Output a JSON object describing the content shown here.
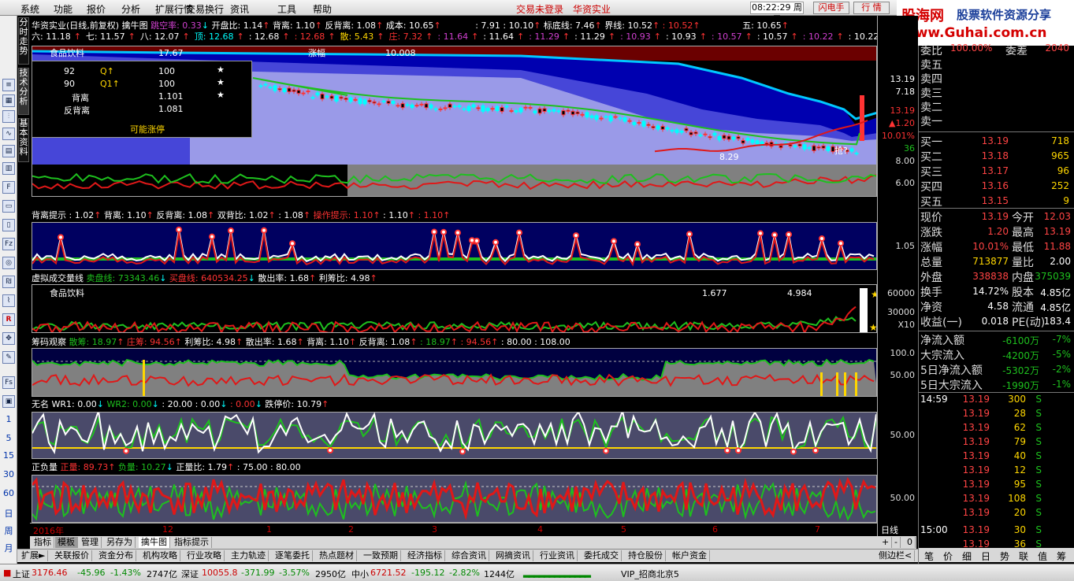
{
  "menu": {
    "items": [
      "系统",
      "功能",
      "报价",
      "分析",
      "扩展行情",
      "交易换行",
      "资讯",
      "工具",
      "帮助"
    ],
    "login": "交易未登录",
    "stock": "华资实业",
    "clock": "08:22:29 周二",
    "flash": "闪电手",
    "quote": "行 情"
  },
  "logo": {
    "line1": "股海网",
    "line1b": "股票软件资源分享",
    "line2": "www.Guhai.com.cn"
  },
  "sidetabs": [
    "分时走势",
    "技术分析",
    "基本资料"
  ],
  "left_nums": [
    "1",
    "5",
    "15",
    "30",
    "60",
    "日",
    "周",
    "月"
  ],
  "main": {
    "row1": {
      "name": "华资实业(日线,前复权)",
      "ind": "擒牛图",
      "a": "跳空率: 0.33",
      "b": "开盘比: 1.14",
      "c": "背离: 1.10",
      "d": "反背离: 1.08",
      "e": "成本: 10.65",
      "f": ": 7.91",
      "g": ": 10.10",
      "h": "标底线: 7.46",
      "i": "界线: 10.52",
      "j": ": 10.52",
      "k": "五: 10.65"
    },
    "row2": [
      "六: 11.18",
      "七: 11.57",
      "八: 12.07",
      "顶: 12.68",
      ": 12.68",
      ": 12.68",
      "散: 5.43",
      "庄: 7.32",
      ": 11.64",
      ": 11.64",
      ": 11.29",
      ": 11.29",
      ": 10.93",
      ": 10.93",
      ": 10.57",
      ": 10.57",
      ": 10.22",
      ": 10.22"
    ],
    "sector": "食品饮料",
    "flag": "17.67",
    "rise_label": "涨幅",
    "rise_val": "10.008",
    "low_label": "8.29",
    "pick_label": "抢?",
    "info": {
      "rows": [
        [
          "92",
          "Q↑",
          "100"
        ],
        [
          "90",
          "Q1↑",
          "100"
        ],
        [
          "",
          "背离",
          "1.101"
        ],
        [
          "",
          "反背离",
          "1.081"
        ]
      ],
      "footer": "可能涨停"
    }
  },
  "p2": {
    "title": "背离提示",
    "vals": [
      ": 1.02",
      "背离: 1.10",
      "反背离: 1.08",
      "双背比: 1.02",
      ": 1.08",
      "操作提示: 1.10",
      ": 1.10",
      ": 1.10"
    ],
    "tick": "1.05"
  },
  "p3": {
    "title": "虚拟成交量线",
    "vals": [
      "卖盘线: 73343.46",
      "买盘线: 640534.25",
      "散出率: 1.68",
      "利筹比: 4.98"
    ],
    "sector": "食品饮料",
    "v1": "1.677",
    "v2": "4.984",
    "ticks": [
      "60000",
      "30000",
      "X10"
    ]
  },
  "p4": {
    "title": "筹码观察",
    "vals": [
      "散筹: 18.97",
      "庄筹: 94.56",
      "利筹比: 4.98",
      "散出率: 1.68",
      "背离: 1.10",
      "反背离: 1.08",
      ": 18.97",
      ": 94.56",
      ": 80.00 : 108.00"
    ],
    "ticks": [
      "100.0",
      "50.00"
    ]
  },
  "p5": {
    "title": "无名",
    "vals": [
      "WR1: 0.00",
      "WR2: 0.00",
      ": 20.00 : 0.00",
      ": 0.00",
      "跌停价: 10.79"
    ],
    "tick": "50.00"
  },
  "p6": {
    "title": "正负量",
    "vals": [
      "正量: 89.73",
      "负量: 10.27",
      "正量比: 1.79",
      ": 75.00 : 80.00"
    ],
    "tick": "50.00"
  },
  "y_main": [
    "13.19",
    "7.18",
    "13.19",
    "▲1.20",
    "10.01%",
    "36",
    "8.00",
    "6.00"
  ],
  "dates": [
    "2016年",
    "12",
    "1",
    "2",
    "3",
    "4",
    "5",
    "6",
    "7"
  ],
  "period": "日线",
  "btabs": [
    "指标",
    "模板",
    "管理",
    "另存为",
    "擒牛图",
    "指标提示"
  ],
  "btabs2": [
    "扩展►",
    "关联报价",
    "资金分布",
    "机构攻略",
    "行业攻略",
    "主力轨迹",
    "逐笔委托",
    "热点题材",
    "一致预期",
    "经济指标",
    "综合资讯",
    "网摘资讯",
    "行业资讯",
    "委托成交",
    "持仓股份",
    "帐户资金",
    "侧边栏<"
  ],
  "status": {
    "sh_label": "上证",
    "sh": "3176.46",
    "sh_chg": "-45.96",
    "sh_pct": "-1.43%",
    "sh_amt": "2747亿",
    "sz_label": "深证",
    "sz": "10055.8",
    "sz_chg": "-371.99",
    "sz_pct": "-3.57%",
    "sz_amt": "2950亿",
    "zx_label": "中小",
    "zx": "6721.52",
    "zx_chg": "-195.12",
    "zx_pct": "-2.82%",
    "zx_amt": "1244亿",
    "vip": "VIP_招商北京5"
  },
  "quote": {
    "sell_top": {
      "label": "委比",
      "val": "100.00%",
      "label2": "委差",
      "val2": "2040"
    },
    "sells": [
      "卖五",
      "卖四",
      "卖三",
      "卖二",
      "卖一"
    ],
    "buys": [
      [
        "买一",
        "13.19",
        "718"
      ],
      [
        "买二",
        "13.18",
        "965"
      ],
      [
        "买三",
        "13.17",
        "96"
      ],
      [
        "买四",
        "13.16",
        "252"
      ],
      [
        "买五",
        "13.15",
        "9"
      ]
    ],
    "stats": [
      [
        "现价",
        "13.19",
        "今开",
        "12.03"
      ],
      [
        "涨跌",
        "1.20",
        "最高",
        "13.19"
      ],
      [
        "涨幅",
        "10.01%",
        "最低",
        "11.88"
      ],
      [
        "总量",
        "713877",
        "量比",
        "2.00"
      ],
      [
        "外盘",
        "338838",
        "内盘",
        "375039"
      ],
      [
        "换手",
        "14.72%",
        "股本",
        "4.85亿"
      ],
      [
        "净资",
        "4.58",
        "流通",
        "4.85亿"
      ],
      [
        "收益(一)",
        "0.018",
        "PE(动)",
        "183.4"
      ]
    ],
    "flows": [
      [
        "净流入额",
        "-6100万",
        "-7%"
      ],
      [
        "大宗流入",
        "-4200万",
        "-5%"
      ],
      [
        "5日净流入额",
        "-5302万",
        "-2%"
      ],
      [
        "5日大宗流入",
        "-1990万",
        "-1%"
      ]
    ],
    "ticks": [
      [
        "14:59",
        "13.19",
        "300",
        "S"
      ],
      [
        "",
        "13.19",
        "28",
        "S"
      ],
      [
        "",
        "13.19",
        "62",
        "S"
      ],
      [
        "",
        "13.19",
        "79",
        "S"
      ],
      [
        "",
        "13.19",
        "40",
        "S"
      ],
      [
        "",
        "13.19",
        "12",
        "S"
      ],
      [
        "",
        "13.19",
        "95",
        "S"
      ],
      [
        "",
        "13.19",
        "108",
        "S"
      ],
      [
        "",
        "13.19",
        "20",
        "S"
      ],
      [
        "15:00",
        "13.19",
        "30",
        "S"
      ],
      [
        "",
        "13.19",
        "36",
        "S"
      ]
    ],
    "tabs": [
      "笔",
      "价",
      "细",
      "日",
      "势",
      "联",
      "值",
      "筹"
    ]
  }
}
